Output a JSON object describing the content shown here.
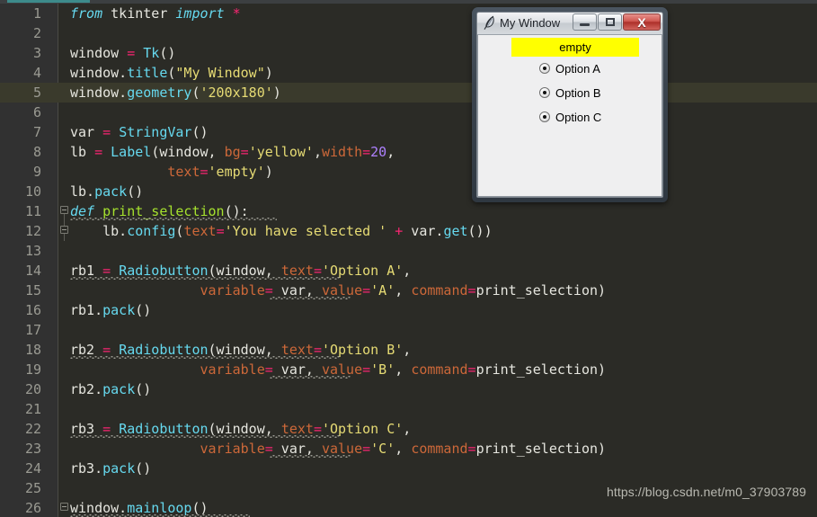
{
  "editor": {
    "watermark": "https://blog.csdn.net/m0_37903789",
    "highlight_line": 5,
    "colors": {
      "background": "#2b2b26",
      "gutter": "#313131",
      "line_highlight": "#3a3a2c",
      "keyword": "#66d9ef",
      "function": "#a6e22e",
      "string": "#e6db74",
      "number": "#ae81ff",
      "operator": "#f92672",
      "kwarg": "#cd6839",
      "text": "#e6e6df",
      "line_number": "#9a9a92"
    },
    "lines": [
      {
        "n": "1",
        "segs": [
          {
            "t": "from ",
            "c": "t-kw"
          },
          {
            "t": "tkinter ",
            "c": "t-plain"
          },
          {
            "t": "import ",
            "c": "t-kw"
          },
          {
            "t": "*",
            "c": "t-op"
          }
        ]
      },
      {
        "n": "2",
        "segs": []
      },
      {
        "n": "3",
        "segs": [
          {
            "t": "window ",
            "c": "t-plain"
          },
          {
            "t": "=",
            "c": "t-op"
          },
          {
            "t": " ",
            "c": "t-plain"
          },
          {
            "t": "Tk",
            "c": "t-builtin"
          },
          {
            "t": "()",
            "c": "t-plain"
          }
        ]
      },
      {
        "n": "4",
        "segs": [
          {
            "t": "window.",
            "c": "t-plain"
          },
          {
            "t": "title",
            "c": "t-method"
          },
          {
            "t": "(",
            "c": "t-plain"
          },
          {
            "t": "\"My Window\"",
            "c": "t-str"
          },
          {
            "t": ")",
            "c": "t-plain"
          }
        ]
      },
      {
        "n": "5",
        "segs": [
          {
            "t": "window.",
            "c": "t-plain"
          },
          {
            "t": "geometry",
            "c": "t-method"
          },
          {
            "t": "(",
            "c": "t-plain"
          },
          {
            "t": "'200x180'",
            "c": "t-str"
          },
          {
            "t": ")",
            "c": "t-plain"
          }
        ]
      },
      {
        "n": "6",
        "segs": []
      },
      {
        "n": "7",
        "segs": [
          {
            "t": "var ",
            "c": "t-plain"
          },
          {
            "t": "=",
            "c": "t-op"
          },
          {
            "t": " ",
            "c": "t-plain"
          },
          {
            "t": "StringVar",
            "c": "t-builtin"
          },
          {
            "t": "()",
            "c": "t-plain"
          }
        ]
      },
      {
        "n": "8",
        "segs": [
          {
            "t": "lb ",
            "c": "t-plain"
          },
          {
            "t": "=",
            "c": "t-op"
          },
          {
            "t": " ",
            "c": "t-plain"
          },
          {
            "t": "Label",
            "c": "t-builtin"
          },
          {
            "t": "(window, ",
            "c": "t-plain"
          },
          {
            "t": "bg",
            "c": "t-kwarg"
          },
          {
            "t": "=",
            "c": "t-op"
          },
          {
            "t": "'yellow'",
            "c": "t-str"
          },
          {
            "t": ",",
            "c": "t-plain"
          },
          {
            "t": "width",
            "c": "t-kwarg"
          },
          {
            "t": "=",
            "c": "t-op"
          },
          {
            "t": "20",
            "c": "t-num"
          },
          {
            "t": ",",
            "c": "t-plain"
          }
        ]
      },
      {
        "n": "9",
        "segs": [
          {
            "t": "            ",
            "c": "t-plain"
          },
          {
            "t": "text",
            "c": "t-kwarg"
          },
          {
            "t": "=",
            "c": "t-op"
          },
          {
            "t": "'empty'",
            "c": "t-str"
          },
          {
            "t": ")",
            "c": "t-plain"
          }
        ]
      },
      {
        "n": "10",
        "segs": [
          {
            "t": "lb.",
            "c": "t-plain"
          },
          {
            "t": "pack",
            "c": "t-method"
          },
          {
            "t": "()",
            "c": "t-plain"
          }
        ]
      },
      {
        "n": "11",
        "segs": [
          {
            "t": "def ",
            "c": "t-kw"
          },
          {
            "t": "print_selection",
            "c": "t-fn"
          },
          {
            "t": "():",
            "c": "t-plain"
          }
        ]
      },
      {
        "n": "12",
        "segs": [
          {
            "t": "    lb.",
            "c": "t-plain"
          },
          {
            "t": "config",
            "c": "t-method"
          },
          {
            "t": "(",
            "c": "t-plain"
          },
          {
            "t": "text",
            "c": "t-kwarg"
          },
          {
            "t": "=",
            "c": "t-op"
          },
          {
            "t": "'You have selected '",
            "c": "t-str"
          },
          {
            "t": " ",
            "c": "t-plain"
          },
          {
            "t": "+",
            "c": "t-op"
          },
          {
            "t": " var.",
            "c": "t-plain"
          },
          {
            "t": "get",
            "c": "t-method"
          },
          {
            "t": "())",
            "c": "t-plain"
          }
        ]
      },
      {
        "n": "13",
        "segs": []
      },
      {
        "n": "14",
        "segs": [
          {
            "t": "rb1 ",
            "c": "t-plain"
          },
          {
            "t": "=",
            "c": "t-op"
          },
          {
            "t": " ",
            "c": "t-plain"
          },
          {
            "t": "Radiobutton",
            "c": "t-builtin"
          },
          {
            "t": "(window, ",
            "c": "t-plain"
          },
          {
            "t": "text",
            "c": "t-kwarg"
          },
          {
            "t": "=",
            "c": "t-op"
          },
          {
            "t": "'Option A'",
            "c": "t-str"
          },
          {
            "t": ",",
            "c": "t-plain"
          }
        ]
      },
      {
        "n": "15",
        "segs": [
          {
            "t": "                ",
            "c": "t-plain"
          },
          {
            "t": "variable",
            "c": "t-kwarg"
          },
          {
            "t": "=",
            "c": "t-op"
          },
          {
            "t": " var, ",
            "c": "t-plain"
          },
          {
            "t": "value",
            "c": "t-kwarg"
          },
          {
            "t": "=",
            "c": "t-op"
          },
          {
            "t": "'A'",
            "c": "t-str"
          },
          {
            "t": ", ",
            "c": "t-plain"
          },
          {
            "t": "command",
            "c": "t-kwarg"
          },
          {
            "t": "=",
            "c": "t-op"
          },
          {
            "t": "print_selection)",
            "c": "t-plain"
          }
        ]
      },
      {
        "n": "16",
        "segs": [
          {
            "t": "rb1.",
            "c": "t-plain"
          },
          {
            "t": "pack",
            "c": "t-method"
          },
          {
            "t": "()",
            "c": "t-plain"
          }
        ]
      },
      {
        "n": "17",
        "segs": []
      },
      {
        "n": "18",
        "segs": [
          {
            "t": "rb2 ",
            "c": "t-plain"
          },
          {
            "t": "=",
            "c": "t-op"
          },
          {
            "t": " ",
            "c": "t-plain"
          },
          {
            "t": "Radiobutton",
            "c": "t-builtin"
          },
          {
            "t": "(window, ",
            "c": "t-plain"
          },
          {
            "t": "text",
            "c": "t-kwarg"
          },
          {
            "t": "=",
            "c": "t-op"
          },
          {
            "t": "'Option B'",
            "c": "t-str"
          },
          {
            "t": ",",
            "c": "t-plain"
          }
        ]
      },
      {
        "n": "19",
        "segs": [
          {
            "t": "                ",
            "c": "t-plain"
          },
          {
            "t": "variable",
            "c": "t-kwarg"
          },
          {
            "t": "=",
            "c": "t-op"
          },
          {
            "t": " var, ",
            "c": "t-plain"
          },
          {
            "t": "value",
            "c": "t-kwarg"
          },
          {
            "t": "=",
            "c": "t-op"
          },
          {
            "t": "'B'",
            "c": "t-str"
          },
          {
            "t": ", ",
            "c": "t-plain"
          },
          {
            "t": "command",
            "c": "t-kwarg"
          },
          {
            "t": "=",
            "c": "t-op"
          },
          {
            "t": "print_selection)",
            "c": "t-plain"
          }
        ]
      },
      {
        "n": "20",
        "segs": [
          {
            "t": "rb2.",
            "c": "t-plain"
          },
          {
            "t": "pack",
            "c": "t-method"
          },
          {
            "t": "()",
            "c": "t-plain"
          }
        ]
      },
      {
        "n": "21",
        "segs": []
      },
      {
        "n": "22",
        "segs": [
          {
            "t": "rb3 ",
            "c": "t-plain"
          },
          {
            "t": "=",
            "c": "t-op"
          },
          {
            "t": " ",
            "c": "t-plain"
          },
          {
            "t": "Radiobutton",
            "c": "t-builtin"
          },
          {
            "t": "(window, ",
            "c": "t-plain"
          },
          {
            "t": "text",
            "c": "t-kwarg"
          },
          {
            "t": "=",
            "c": "t-op"
          },
          {
            "t": "'Option C'",
            "c": "t-str"
          },
          {
            "t": ",",
            "c": "t-plain"
          }
        ]
      },
      {
        "n": "23",
        "segs": [
          {
            "t": "                ",
            "c": "t-plain"
          },
          {
            "t": "variable",
            "c": "t-kwarg"
          },
          {
            "t": "=",
            "c": "t-op"
          },
          {
            "t": " var, ",
            "c": "t-plain"
          },
          {
            "t": "value",
            "c": "t-kwarg"
          },
          {
            "t": "=",
            "c": "t-op"
          },
          {
            "t": "'C'",
            "c": "t-str"
          },
          {
            "t": ", ",
            "c": "t-plain"
          },
          {
            "t": "command",
            "c": "t-kwarg"
          },
          {
            "t": "=",
            "c": "t-op"
          },
          {
            "t": "print_selection)",
            "c": "t-plain"
          }
        ]
      },
      {
        "n": "24",
        "segs": [
          {
            "t": "rb3.",
            "c": "t-plain"
          },
          {
            "t": "pack",
            "c": "t-method"
          },
          {
            "t": "()",
            "c": "t-plain"
          }
        ]
      },
      {
        "n": "25",
        "segs": []
      },
      {
        "n": "26",
        "segs": [
          {
            "t": "window.",
            "c": "t-plain"
          },
          {
            "t": "mainloop",
            "c": "t-method"
          },
          {
            "t": "()",
            "c": "t-plain"
          }
        ]
      }
    ]
  },
  "tk_window": {
    "title": "My Window",
    "icon": "feather-icon",
    "buttons": {
      "minimize": "minimize-button",
      "maximize": "maximize-button",
      "close_glyph": "X"
    },
    "label": {
      "text": "empty",
      "background": "#ffff00",
      "foreground": "#000000"
    },
    "radios": [
      {
        "label": "Option A",
        "value": "A"
      },
      {
        "label": "Option B",
        "value": "B"
      },
      {
        "label": "Option C",
        "value": "C"
      }
    ]
  }
}
